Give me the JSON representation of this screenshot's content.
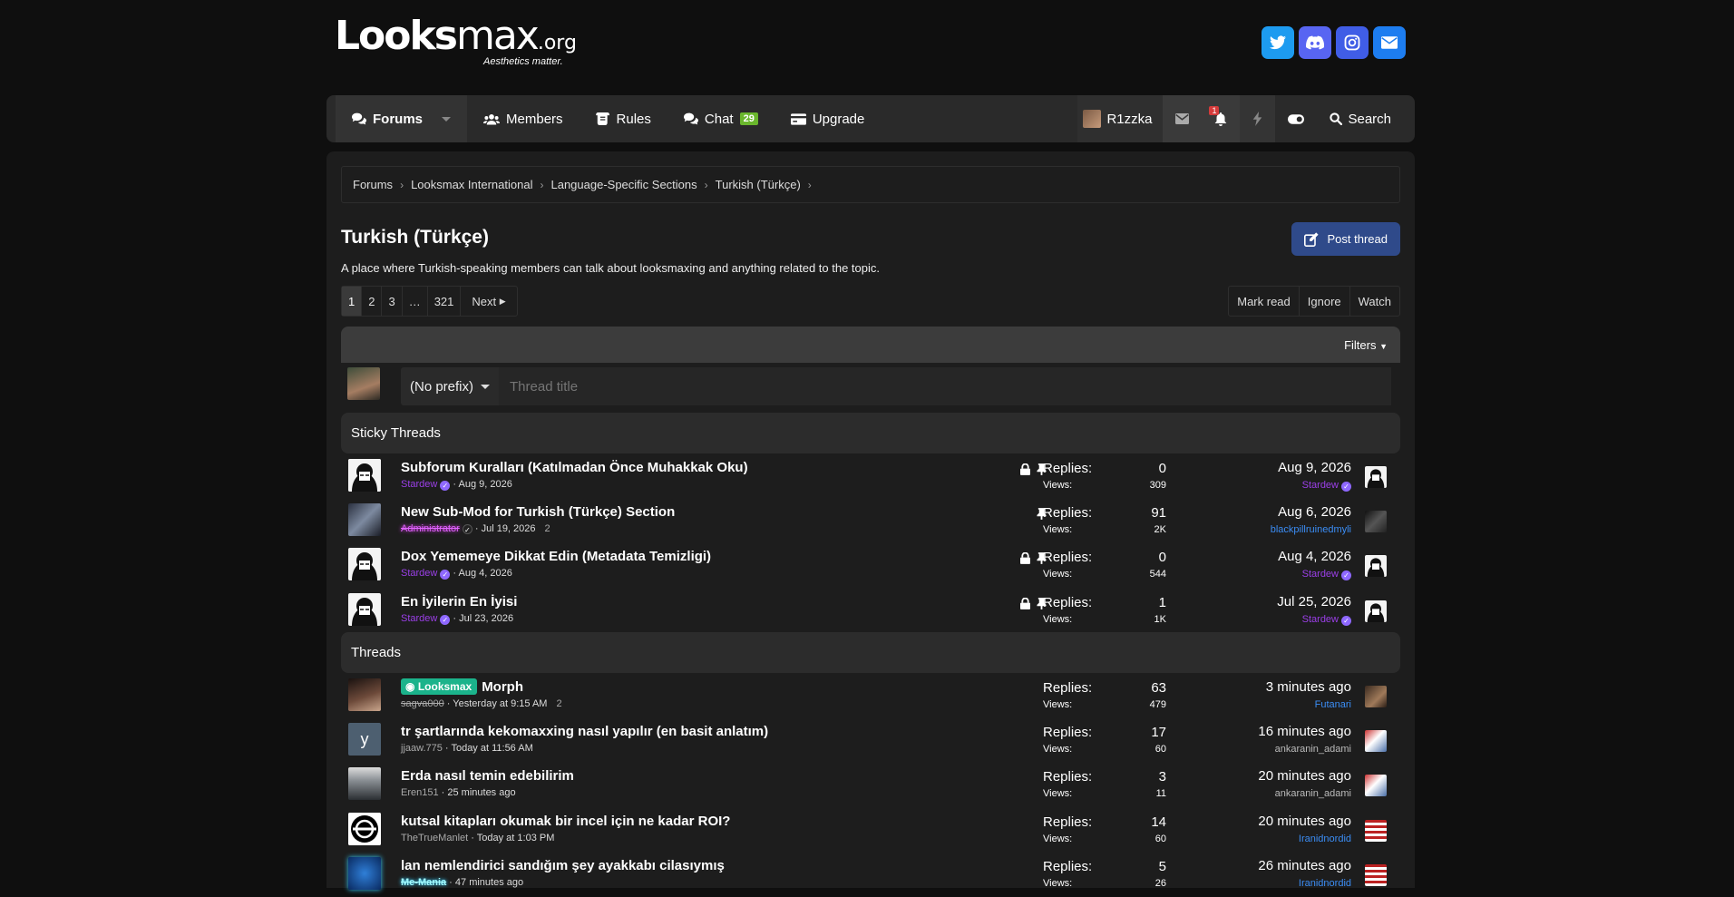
{
  "brand": {
    "logo_bold": "Looks",
    "logo_rest": "max",
    "logo_tld": ".org",
    "tagline": "Aesthetics matter."
  },
  "socials": [
    {
      "name": "twitter-icon",
      "glyph": "t",
      "color": "#1d9bf0"
    },
    {
      "name": "discord-icon",
      "glyph": "d",
      "color": "#5865f2"
    },
    {
      "name": "instagram-icon",
      "glyph": "◎",
      "color": "#405de6"
    },
    {
      "name": "mail-icon",
      "glyph": "✉",
      "color": "#1d7df0"
    }
  ],
  "nav": {
    "forums": "Forums",
    "members": "Members",
    "rules": "Rules",
    "chat": "Chat",
    "chat_badge": "29",
    "upgrade": "Upgrade",
    "username": "R1zzka",
    "alert_count": "1",
    "search": "Search"
  },
  "breadcrumbs": [
    "Forums",
    "Looksmax International",
    "Language-Specific Sections",
    "Turkish (Türkçe)"
  ],
  "forum": {
    "title": "Turkish (Türkçe)",
    "description": "A place where Turkish-speaking members can talk about looksmaxing and anything related to the topic.",
    "post_thread": "Post thread"
  },
  "pagination": {
    "pages": [
      "1",
      "2",
      "3",
      "…",
      "321"
    ],
    "next": "Next"
  },
  "actions": {
    "mark_read": "Mark read",
    "ignore": "Ignore",
    "watch": "Watch"
  },
  "filters": "Filters",
  "quick_thread": {
    "prefix": "(No prefix)",
    "placeholder": "Thread title"
  },
  "sections": {
    "sticky": "Sticky Threads",
    "threads": "Threads"
  },
  "labels": {
    "replies": "Replies:",
    "views": "Views:"
  },
  "sticky_threads": [
    {
      "title": "Subforum Kuralları (Katılmadan Önce Muhakkak Oku)",
      "author": "Stardew",
      "date": "Aug 9, 2026",
      "pages": "",
      "replies": "0",
      "views": "309",
      "last_date": "Aug 9, 2026",
      "last_user": "Stardew"
    },
    {
      "title": "New Sub-Mod for Turkish (Türkçe) Section",
      "author": "Administrator",
      "date": "Jul 19, 2026",
      "pages": "2",
      "replies": "91",
      "views": "2K",
      "last_date": "Aug 6, 2026",
      "last_user": "blackpillruinedmyli"
    },
    {
      "title": "Dox Yememeye Dikkat Edin (Metadata Temizligi)",
      "author": "Stardew",
      "date": "Aug 4, 2026",
      "pages": "",
      "replies": "0",
      "views": "544",
      "last_date": "Aug 4, 2026",
      "last_user": "Stardew"
    },
    {
      "title": "En İyilerin En İyisi",
      "author": "Stardew",
      "date": "Jul 23, 2026",
      "pages": "",
      "replies": "1",
      "views": "1K",
      "last_date": "Jul 25, 2026",
      "last_user": "Stardew"
    }
  ],
  "threads": [
    {
      "prefix": "Looksmax",
      "title": "Morph",
      "author": "sagva000",
      "date": "Yesterday at 9:15 AM",
      "pages": "2",
      "replies": "63",
      "views": "479",
      "last_date": "3 minutes ago",
      "last_user": "Futanari"
    },
    {
      "prefix": "",
      "title": "tr şartlarında kekomaxxing nasıl yapılır (en basit anlatım)",
      "author": "jjaaw.775",
      "date": "Today at 11:56 AM",
      "pages": "",
      "replies": "17",
      "views": "60",
      "last_date": "16 minutes ago",
      "last_user": "ankaranin_adami",
      "avatar_letter": "y"
    },
    {
      "prefix": "",
      "title": "Erda nasıl temin edebilirim",
      "author": "Eren151",
      "date": "25 minutes ago",
      "pages": "",
      "replies": "3",
      "views": "11",
      "last_date": "20 minutes ago",
      "last_user": "ankaranin_adami"
    },
    {
      "prefix": "",
      "title": "kutsal kitapları okumak bir incel için ne kadar ROI?",
      "author": "TheTrueManlet",
      "date": "Today at 1:03 PM",
      "pages": "",
      "replies": "14",
      "views": "60",
      "last_date": "20 minutes ago",
      "last_user": "Iranidnordid"
    },
    {
      "prefix": "",
      "title": "lan nemlendirici sandığım şey ayakkabı cilasıymış",
      "author": "Me-Mania",
      "date": "47 minutes ago",
      "pages": "",
      "replies": "5",
      "views": "26",
      "last_date": "26 minutes ago",
      "last_user": "Iranidnordid"
    }
  ]
}
